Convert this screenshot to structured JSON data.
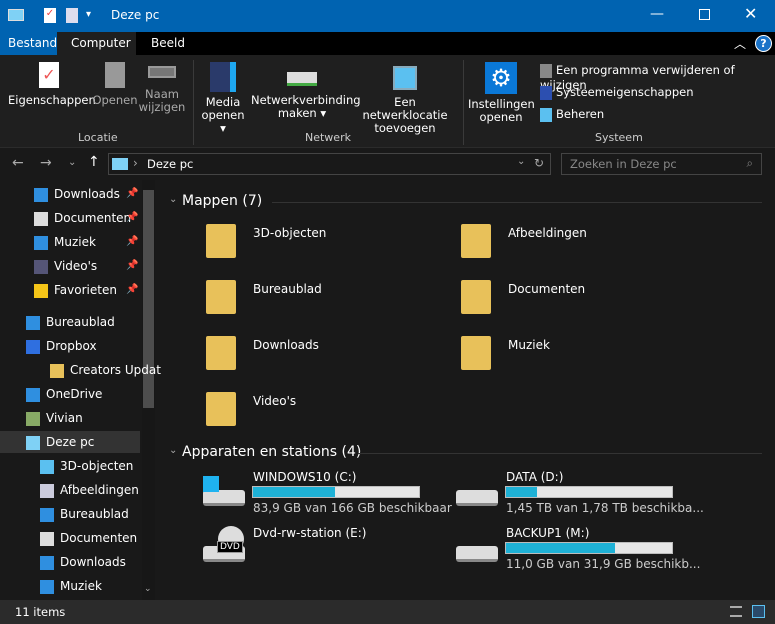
{
  "window": {
    "title": "Deze pc",
    "colors": {
      "titlebar": "#0063b1",
      "accent": "#1eb1d6"
    }
  },
  "tabs": [
    {
      "label": "Bestand"
    },
    {
      "label": "Computer"
    },
    {
      "label": "Beeld"
    }
  ],
  "ribbon": {
    "locatie": {
      "label": "Locatie",
      "buttons": [
        {
          "label": "Eigenschappen"
        },
        {
          "label": "Openen"
        },
        {
          "label": "Naam",
          "label2": "wijzigen"
        }
      ]
    },
    "netwerk": {
      "label": "Netwerk",
      "buttons": [
        {
          "label": "Media",
          "label2": "openen ▾"
        },
        {
          "label": "Netwerkverbinding",
          "label2": "maken ▾"
        },
        {
          "label": "Een netwerklocatie",
          "label2": "toevoegen"
        }
      ]
    },
    "systeem": {
      "label": "Systeem",
      "settings": {
        "label": "Instellingen",
        "label2": "openen"
      },
      "items": [
        {
          "label": "Een programma verwijderen of wijzigen"
        },
        {
          "label": "Systeemeigenschappen"
        },
        {
          "label": "Beheren"
        }
      ]
    }
  },
  "address": {
    "path": "Deze pc",
    "search_placeholder": "Zoeken in Deze pc"
  },
  "sidebar": [
    {
      "label": "Downloads",
      "pinned": true
    },
    {
      "label": "Documenten",
      "pinned": true
    },
    {
      "label": "Muziek",
      "pinned": true
    },
    {
      "label": "Video's",
      "pinned": true
    },
    {
      "label": "Favorieten",
      "pinned": true
    },
    {
      "label": "Bureaublad"
    },
    {
      "label": "Dropbox"
    },
    {
      "label": "Creators Updat"
    },
    {
      "label": "OneDrive"
    },
    {
      "label": "Vivian"
    },
    {
      "label": "Deze pc",
      "selected": true
    },
    {
      "label": "3D-objecten"
    },
    {
      "label": "Afbeeldingen"
    },
    {
      "label": "Bureaublad"
    },
    {
      "label": "Documenten"
    },
    {
      "label": "Downloads"
    },
    {
      "label": "Muziek"
    }
  ],
  "folders_header": "Mappen (7)",
  "folders": [
    {
      "label": "3D-objecten"
    },
    {
      "label": "Afbeeldingen"
    },
    {
      "label": "Bureaublad"
    },
    {
      "label": "Documenten"
    },
    {
      "label": "Downloads"
    },
    {
      "label": "Muziek"
    },
    {
      "label": "Video's"
    }
  ],
  "drives_header": "Apparaten en stations (4)",
  "drives": [
    {
      "label": "WINDOWS10 (C:)",
      "info": "83,9 GB van 166 GB beschikbaar",
      "used_percent": 49.5
    },
    {
      "label": "DATA (D:)",
      "info": "1,45 TB van 1,78 TB beschikba...",
      "used_percent": 18.5
    },
    {
      "label": "Dvd-rw-station (E:)",
      "dvd": "DVD"
    },
    {
      "label": "BACKUP1 (M:)",
      "info": "11,0 GB van 31,9 GB beschikb...",
      "used_percent": 65.5
    }
  ],
  "status": {
    "items": "11 items"
  }
}
